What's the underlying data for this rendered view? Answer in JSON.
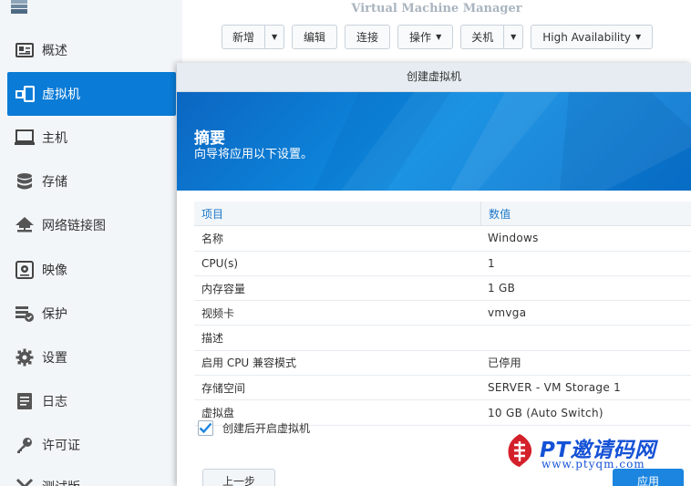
{
  "window": {
    "title": "Virtual Machine Manager"
  },
  "sidebar": {
    "items": [
      {
        "label": "概述",
        "icon": "overview-card-icon"
      },
      {
        "label": "虚拟机",
        "icon": "virtual-machine-icon",
        "active": true
      },
      {
        "label": "主机",
        "icon": "monitor-icon"
      },
      {
        "label": "存储",
        "icon": "database-icon"
      },
      {
        "label": "网络链接图",
        "icon": "network-icon"
      },
      {
        "label": "映像",
        "icon": "disk-image-icon"
      },
      {
        "label": "保护",
        "icon": "protection-icon"
      },
      {
        "label": "设置",
        "icon": "gear-icon"
      },
      {
        "label": "日志",
        "icon": "log-icon"
      },
      {
        "label": "许可证",
        "icon": "key-icon"
      },
      {
        "label": "测试版",
        "icon": "beta-icon"
      }
    ]
  },
  "toolbar": {
    "create": "新增",
    "edit": "编辑",
    "connect": "连接",
    "action": "操作",
    "shutdown": "关机",
    "high_availability": "High Availability"
  },
  "dialog": {
    "title": "创建虚拟机",
    "banner_title": "摘要",
    "banner_subtitle": "向导将应用以下设置。",
    "columns": {
      "item": "项目",
      "value": "数值"
    },
    "rows": [
      {
        "item": "名称",
        "value": "Windows"
      },
      {
        "item": "CPU(s)",
        "value": "1"
      },
      {
        "item": "内存容量",
        "value": "1 GB"
      },
      {
        "item": "视频卡",
        "value": "vmvga"
      },
      {
        "item": "描述",
        "value": ""
      },
      {
        "item": "启用 CPU 兼容模式",
        "value": "已停用"
      },
      {
        "item": "存储空间",
        "value": "SERVER - VM Storage 1"
      },
      {
        "item": "虚拟盘",
        "value": "10 GB (Auto Switch)"
      }
    ],
    "checkbox_label": "创建后开启虚拟机",
    "checkbox_checked": true,
    "prev_button": "上一步",
    "apply_button": "应用"
  },
  "watermark": {
    "brand": "PT邀请码网",
    "url": "www.ptyqm.com"
  },
  "colors": {
    "accent": "#0a7bd6",
    "banner": "#0e8de2",
    "header_text": "#1b78c8"
  }
}
